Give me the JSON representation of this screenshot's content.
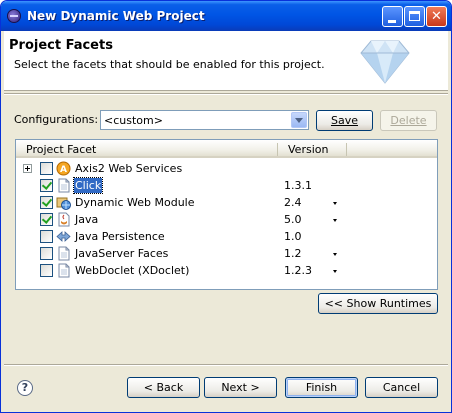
{
  "window": {
    "title": "New Dynamic Web Project"
  },
  "header": {
    "title": "Project Facets",
    "description": "Select the facets that should be enabled for this project."
  },
  "configurations": {
    "label": "Configurations:",
    "value": "<custom>",
    "save_label": "Save",
    "delete_label": "Delete"
  },
  "table": {
    "columns": [
      "Project Facet",
      "Version"
    ],
    "rows": [
      {
        "name": "Axis2 Web Services",
        "version": "",
        "checked": false,
        "expander": true,
        "dropdown": false,
        "icon": "axis2-icon"
      },
      {
        "name": "Click",
        "version": "1.3.1",
        "checked": true,
        "selected": true,
        "dropdown": false,
        "icon": "page-icon"
      },
      {
        "name": "Dynamic Web Module",
        "version": "2.4",
        "checked": true,
        "dropdown": true,
        "icon": "web-module-icon"
      },
      {
        "name": "Java",
        "version": "5.0",
        "checked": true,
        "dropdown": true,
        "icon": "java-icon"
      },
      {
        "name": "Java Persistence",
        "version": "1.0",
        "checked": false,
        "dropdown": false,
        "icon": "persistence-icon"
      },
      {
        "name": "JavaServer Faces",
        "version": "1.2",
        "checked": false,
        "dropdown": true,
        "icon": "page-icon"
      },
      {
        "name": "WebDoclet (XDoclet)",
        "version": "1.2.3",
        "checked": false,
        "dropdown": true,
        "icon": "page-icon"
      }
    ]
  },
  "show_runtimes_label": "<< Show Runtimes",
  "footer": {
    "back_label": "< Back",
    "next_label": "Next >",
    "finish_label": "Finish",
    "cancel_label": "Cancel"
  }
}
